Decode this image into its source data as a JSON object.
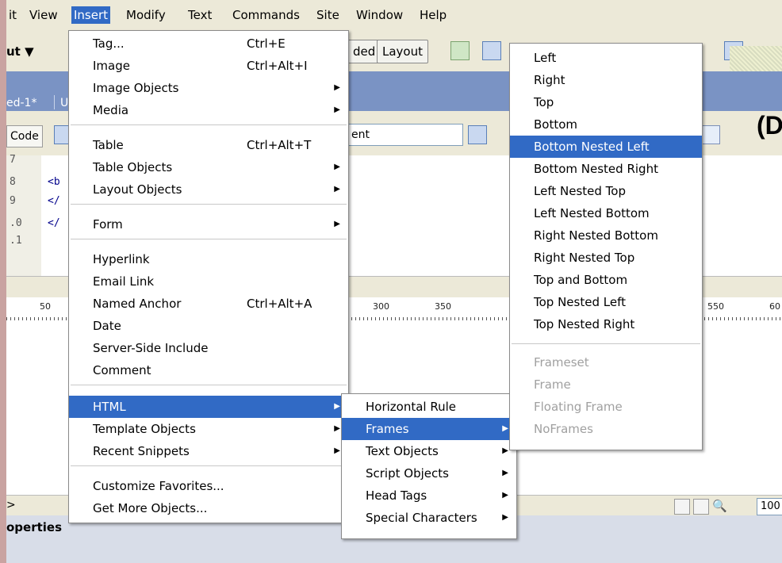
{
  "menubar": [
    "it",
    "View",
    "Insert",
    "Modify",
    "Text",
    "Commands",
    "Site",
    "Window",
    "Help"
  ],
  "toolbar": {
    "layout_label": "ut ▼",
    "btn_left": "ded",
    "btn_layout": "Layout"
  },
  "document": {
    "tab": "ed-1*",
    "tab2": "U",
    "code_button": "Code",
    "title_field": "ent"
  },
  "code": {
    "line_numbers": [
      "7",
      "8",
      "9",
      ".0",
      ".1"
    ],
    "lines": [
      "<b",
      "</",
      "</"
    ]
  },
  "ruler": {
    "ticks": [
      "50",
      "300",
      "350",
      "550",
      "60"
    ]
  },
  "status": {
    "tag": ">",
    "zoom": "100"
  },
  "properties": {
    "title": "operties"
  },
  "brand": {
    "text": "(D"
  },
  "insert_menu": {
    "items": [
      {
        "label": "Tag...",
        "shortcut": "Ctrl+E"
      },
      {
        "label": "Image",
        "shortcut": "Ctrl+Alt+I"
      },
      {
        "label": "Image Objects",
        "submenu": true
      },
      {
        "label": "Media",
        "submenu": true
      },
      {
        "label": "Table",
        "shortcut": "Ctrl+Alt+T"
      },
      {
        "label": "Table Objects",
        "submenu": true
      },
      {
        "label": "Layout Objects",
        "submenu": true
      },
      {
        "label": "Form",
        "submenu": true
      },
      {
        "label": "Hyperlink"
      },
      {
        "label": "Email Link"
      },
      {
        "label": "Named Anchor",
        "shortcut": "Ctrl+Alt+A"
      },
      {
        "label": "Date"
      },
      {
        "label": "Server-Side Include"
      },
      {
        "label": "Comment"
      },
      {
        "label": "HTML",
        "submenu": true,
        "highlighted": true
      },
      {
        "label": "Template Objects",
        "submenu": true
      },
      {
        "label": "Recent Snippets",
        "submenu": true
      },
      {
        "label": "Customize Favorites..."
      },
      {
        "label": "Get More Objects..."
      }
    ]
  },
  "html_submenu": {
    "items": [
      {
        "label": "Horizontal Rule"
      },
      {
        "label": "Frames",
        "submenu": true,
        "highlighted": true
      },
      {
        "label": "Text Objects",
        "submenu": true
      },
      {
        "label": "Script Objects",
        "submenu": true
      },
      {
        "label": "Head Tags",
        "submenu": true
      },
      {
        "label": "Special Characters",
        "submenu": true
      }
    ]
  },
  "frames_submenu": {
    "items": [
      {
        "label": "Left"
      },
      {
        "label": "Right"
      },
      {
        "label": "Top"
      },
      {
        "label": "Bottom"
      },
      {
        "label": "Bottom Nested Left",
        "highlighted": true
      },
      {
        "label": "Bottom Nested Right"
      },
      {
        "label": "Left Nested Top"
      },
      {
        "label": "Left Nested Bottom"
      },
      {
        "label": "Right Nested Bottom"
      },
      {
        "label": "Right Nested Top"
      },
      {
        "label": "Top and Bottom"
      },
      {
        "label": "Top Nested Left"
      },
      {
        "label": "Top Nested Right"
      },
      {
        "label": "Frameset",
        "disabled": true
      },
      {
        "label": "Frame",
        "disabled": true
      },
      {
        "label": "Floating Frame",
        "disabled": true
      },
      {
        "label": "NoFrames",
        "disabled": true
      }
    ]
  }
}
